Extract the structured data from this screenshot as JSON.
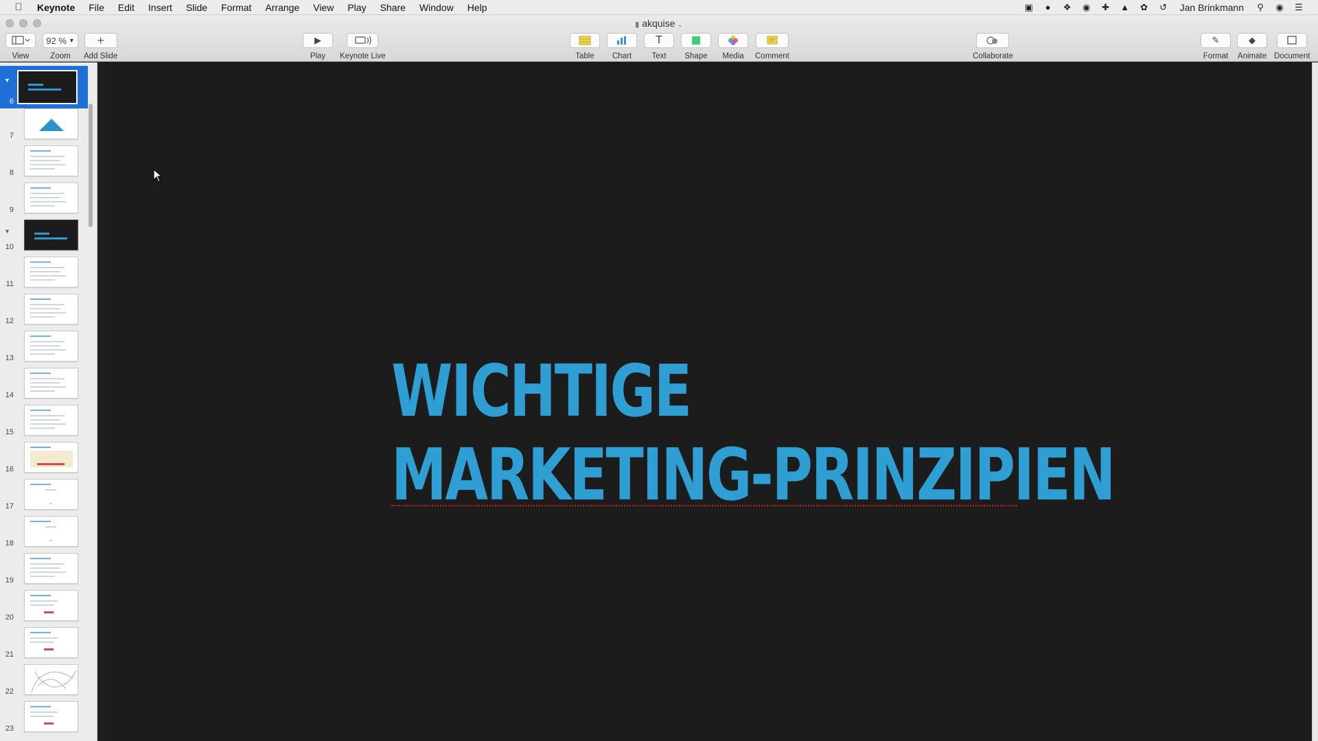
{
  "menubar": {
    "apple_icon": "apple-logo-icon",
    "app_name": "Keynote",
    "items": [
      "File",
      "Edit",
      "Insert",
      "Slide",
      "Format",
      "Arrange",
      "View",
      "Play",
      "Share",
      "Window",
      "Help"
    ],
    "status_icons": [
      "screen-record-icon",
      "creative-cloud-icon",
      "dropbox-icon",
      "onepassword-icon",
      "plus-icon",
      "ghost-icon",
      "leaf-icon",
      "time-machine-icon"
    ],
    "user_name": "Jan Brinkmann",
    "right_icons": [
      "spotlight-icon",
      "siri-icon",
      "notification-center-icon"
    ]
  },
  "window": {
    "document_title": "akquise"
  },
  "toolbar": {
    "view_label": "View",
    "zoom_value": "92 %",
    "zoom_label": "Zoom",
    "add_slide_label": "Add Slide",
    "play_label": "Play",
    "keynote_live_label": "Keynote Live",
    "table_label": "Table",
    "chart_label": "Chart",
    "text_label": "Text",
    "shape_label": "Shape",
    "media_label": "Media",
    "comment_label": "Comment",
    "collaborate_label": "Collaborate",
    "format_label": "Format",
    "animate_label": "Animate",
    "document_label": "Document",
    "colors": {
      "table": "#f2d24a",
      "chart": "#3f8fd6",
      "shape": "#3ecf7a",
      "comment": "#f2d24a"
    }
  },
  "navigator": {
    "selected_slide": "6",
    "slides": [
      {
        "number": "6",
        "kind": "dark-title",
        "collapsible": true
      },
      {
        "number": "7",
        "kind": "triangle"
      },
      {
        "number": "8",
        "kind": "text"
      },
      {
        "number": "9",
        "kind": "text"
      },
      {
        "number": "10",
        "kind": "dark-title",
        "collapsible": true
      },
      {
        "number": "11",
        "kind": "text"
      },
      {
        "number": "12",
        "kind": "text"
      },
      {
        "number": "13",
        "kind": "text"
      },
      {
        "number": "14",
        "kind": "text"
      },
      {
        "number": "15",
        "kind": "text"
      },
      {
        "number": "16",
        "kind": "beige"
      },
      {
        "number": "17",
        "kind": "sparse"
      },
      {
        "number": "18",
        "kind": "sparse"
      },
      {
        "number": "19",
        "kind": "text"
      },
      {
        "number": "20",
        "kind": "red"
      },
      {
        "number": "21",
        "kind": "red"
      },
      {
        "number": "22",
        "kind": "drawing"
      },
      {
        "number": "23",
        "kind": "red"
      }
    ]
  },
  "slide": {
    "title_line_1": "WICHTIGE",
    "title_line_2": "MARKETING-PRINZIPIEN",
    "title_color": "#2f9fd3",
    "background": "#1c1c1c"
  }
}
